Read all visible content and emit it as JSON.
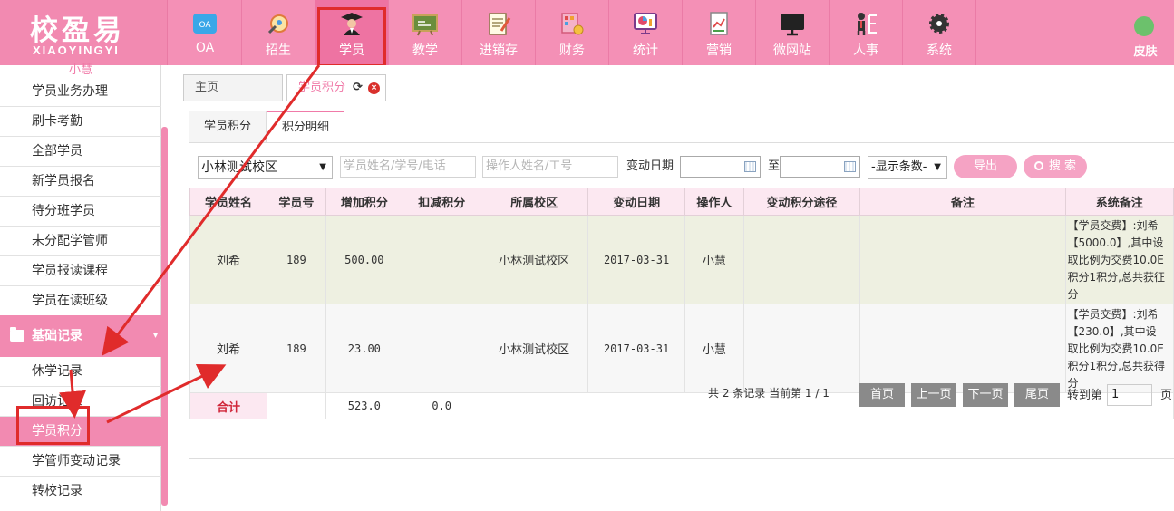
{
  "logo": {
    "cn": "校盈易",
    "en": "XIAOYINGYI"
  },
  "nav": [
    {
      "label": "OA",
      "icon": "oa-icon"
    },
    {
      "label": "招生",
      "icon": "enrollment-icon"
    },
    {
      "label": "学员",
      "icon": "student-icon",
      "active": true
    },
    {
      "label": "教学",
      "icon": "teaching-icon"
    },
    {
      "label": "进销存",
      "icon": "inventory-icon"
    },
    {
      "label": "财务",
      "icon": "finance-icon"
    },
    {
      "label": "统计",
      "icon": "statistics-icon"
    },
    {
      "label": "营销",
      "icon": "marketing-icon"
    },
    {
      "label": "微网站",
      "icon": "microsite-icon"
    },
    {
      "label": "人事",
      "icon": "hr-icon"
    },
    {
      "label": "系统",
      "icon": "system-gear-icon"
    }
  ],
  "skin_label": "皮肤",
  "sidebar": {
    "cut_text": "小慧",
    "items_top": [
      "学员业务办理",
      "刷卡考勤",
      "全部学员",
      "新学员报名",
      "待分班学员",
      "未分配学管师",
      "学员报读课程",
      "学员在读班级"
    ],
    "group_label": "基础记录",
    "items_bottom": [
      "休学记录",
      "回访记录",
      "学员积分",
      "学管师变动记录",
      "转校记录"
    ]
  },
  "page_tabs": {
    "home": "主页",
    "current": "学员积分",
    "reload": "C",
    "close": "×"
  },
  "sub_tabs": [
    "学员积分",
    "积分明细"
  ],
  "filters": {
    "campus": "小林测试校区",
    "student_placeholder": "学员姓名/学号/电话",
    "operator_placeholder": "操作人姓名/工号",
    "date_label": "变动日期",
    "to_label": "至",
    "rows_select": "-显示条数-",
    "export_label": "导出",
    "search_label": "搜 索"
  },
  "table": {
    "headers": [
      "学员姓名",
      "学员号",
      "增加积分",
      "扣减积分",
      "所属校区",
      "变动日期",
      "操作人",
      "变动积分途径",
      "备注",
      "系统备注"
    ],
    "rows": [
      {
        "name": "刘希",
        "no": "189",
        "add": "500.00",
        "sub": "",
        "campus": "小林测试校区",
        "date": "2017-03-31",
        "operator": "小慧",
        "way": "",
        "remark": "",
        "sys_note": [
          "【学员交费】:刘希",
          "【5000.0】,其中设",
          "取比例为交费10.0E",
          "积分1积分,总共获征",
          "分"
        ]
      },
      {
        "name": "刘希",
        "no": "189",
        "add": "23.00",
        "sub": "",
        "campus": "小林测试校区",
        "date": "2017-03-31",
        "operator": "小慧",
        "way": "",
        "remark": "",
        "sys_note": [
          "【学员交费】:刘希",
          "【230.0】,其中设",
          "取比例为交费10.0E",
          "积分1积分,总共获得",
          "分"
        ]
      }
    ],
    "sum": {
      "label": "合计",
      "add": "523.0",
      "sub": "0.0"
    }
  },
  "pager": {
    "info": "共 2 条记录 当前第 1 / 1",
    "first": "首页",
    "prev": "上一页",
    "next": "下一页",
    "last": "尾页",
    "goto": "转到第",
    "page_value": "1",
    "page_suffix": "页"
  },
  "colors": {
    "brand": "#f490b6",
    "highlight_box": "#e02b2b",
    "export_btn": "#f5a3c4",
    "pager_btn": "#8a8a8a"
  }
}
